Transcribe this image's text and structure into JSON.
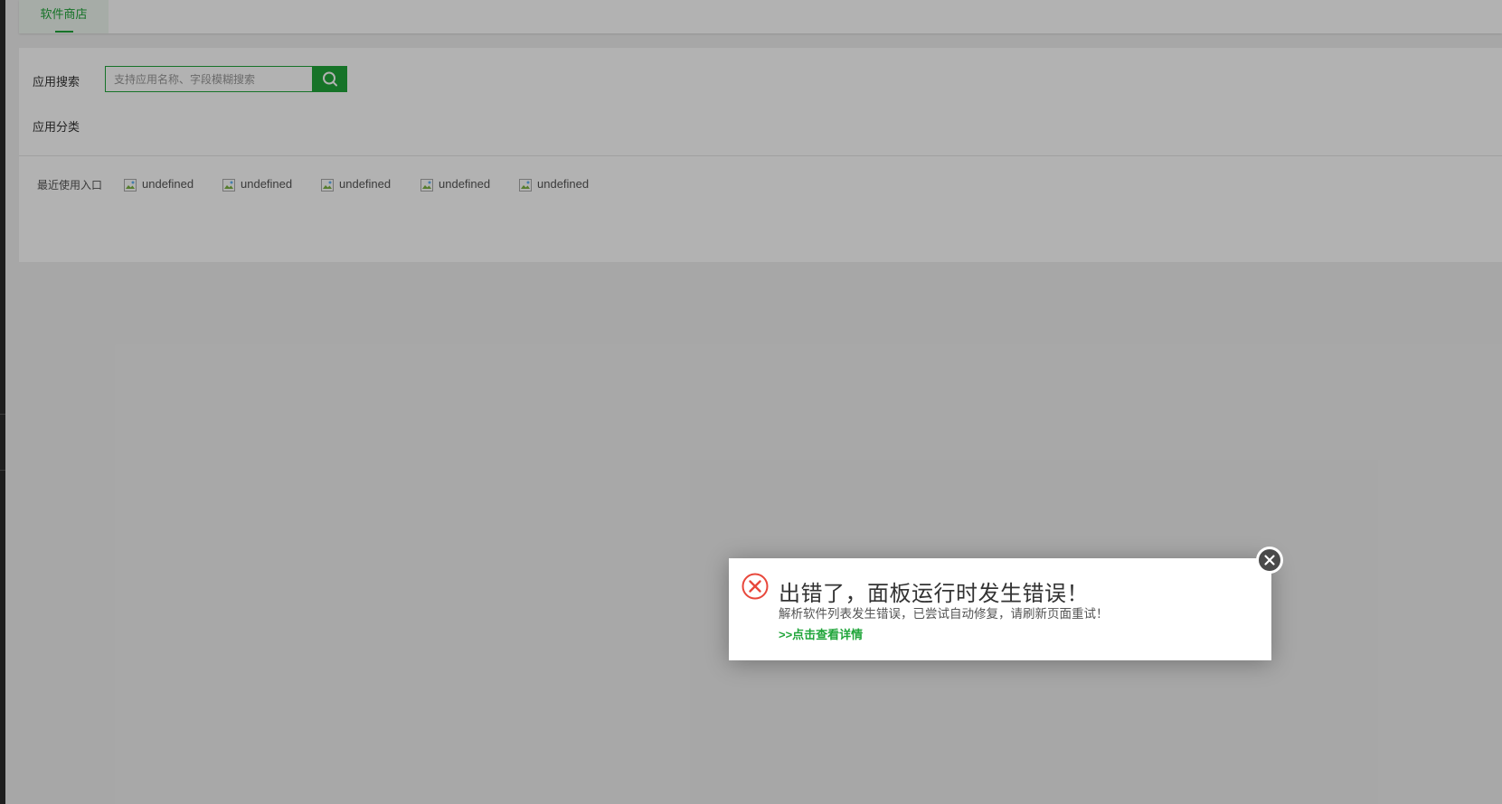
{
  "tabs": [
    {
      "label": "软件商店",
      "active": true
    }
  ],
  "search": {
    "label": "应用搜索",
    "placeholder": "支持应用名称、字段模糊搜索",
    "value": "",
    "button_icon": "search-icon"
  },
  "category": {
    "label": "应用分类"
  },
  "recent": {
    "label": "最近使用入口",
    "items": [
      {
        "label": "undefined",
        "icon": "broken-image-icon"
      },
      {
        "label": "undefined",
        "icon": "broken-image-icon"
      },
      {
        "label": "undefined",
        "icon": "broken-image-icon"
      },
      {
        "label": "undefined",
        "icon": "broken-image-icon"
      },
      {
        "label": "undefined",
        "icon": "broken-image-icon"
      }
    ]
  },
  "error_dialog": {
    "icon": "error-circle-icon",
    "title": "出错了，面板运行时发生错误！",
    "message": "解析软件列表发生错误，已尝试自动修复，请刷新页面重试！",
    "link": ">>点击查看详情",
    "close_icon": "close-icon"
  },
  "colors": {
    "accent": "#20a53a",
    "error": "#e8473b",
    "overlay": "rgba(0,0,0,0.3)"
  }
}
